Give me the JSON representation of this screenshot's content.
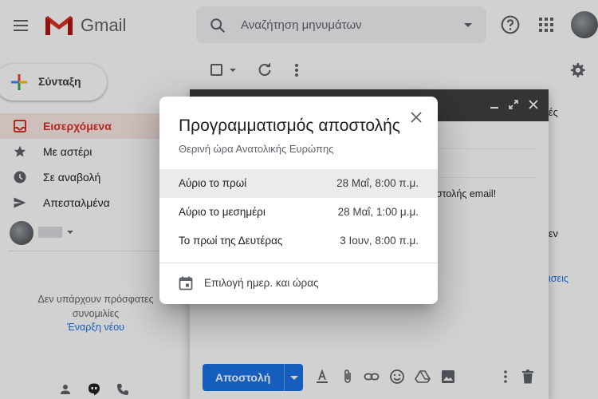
{
  "header": {
    "app_name": "Gmail",
    "search_placeholder": "Αναζήτηση μηνυμάτων"
  },
  "sidebar": {
    "compose_label": "Σύνταξη",
    "items": [
      {
        "label": "Εισερχόμενα",
        "icon": "inbox-icon",
        "active": true
      },
      {
        "label": "Με αστέρι",
        "icon": "star-icon",
        "active": false
      },
      {
        "label": "Σε αναβολή",
        "icon": "clock-icon",
        "active": false
      },
      {
        "label": "Απεσταλμένα",
        "icon": "send-icon",
        "active": false
      }
    ],
    "no_chats_text": "Δεν υπάρχουν πρόσφατες συνομιλίες",
    "start_new_link": "Έναρξη νέου"
  },
  "compose": {
    "body_snippet": "οστολής email!",
    "send_label": "Αποστολή"
  },
  "right_panel": {
    "text_1": "ές",
    "text_2": "εν",
    "link_1": "ισεις"
  },
  "dialog": {
    "title": "Προγραμματισμός αποστολής",
    "subtitle": "Θερινή ώρα Ανατολικής Ευρώπης",
    "options": [
      {
        "label": "Αύριο το πρωί",
        "time": "28 Μαΐ, 8:00 π.μ.",
        "highlighted": true
      },
      {
        "label": "Αύριο το μεσημέρι",
        "time": "28 Μαΐ, 1:00 μ.μ.",
        "highlighted": false
      },
      {
        "label": "Το πρωί της Δευτέρας",
        "time": "3 Ιουν, 8:00 π.μ.",
        "highlighted": false
      }
    ],
    "pick_label": "Επιλογή ημερ. και ώρας"
  },
  "colors": {
    "accent": "#1a73e8",
    "inbox_active": "#d93025",
    "compose_header": "#404040"
  }
}
